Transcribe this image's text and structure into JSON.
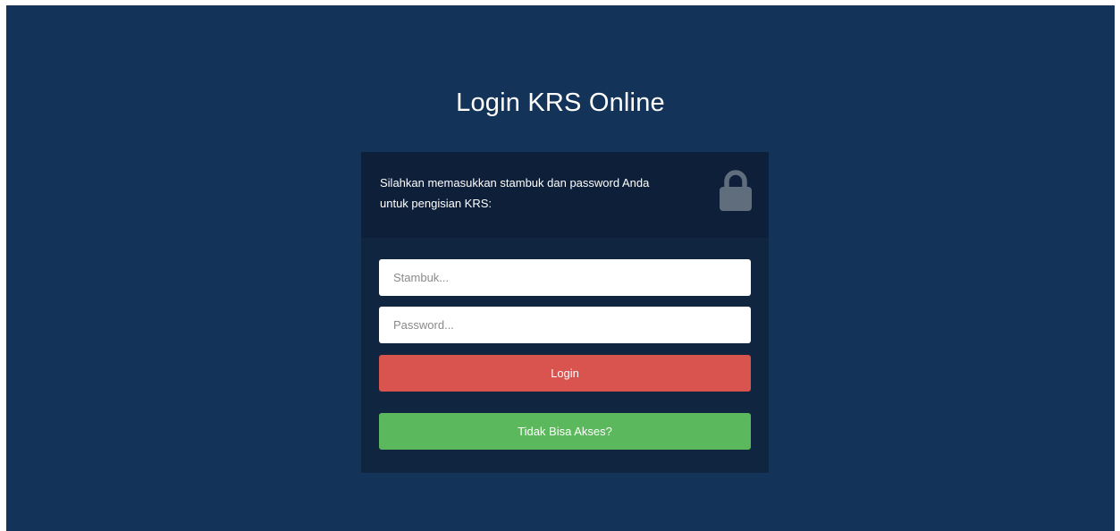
{
  "page": {
    "title": "Login KRS Online"
  },
  "login_card": {
    "instruction_line1": "Silahkan memasukkan stambuk dan password Anda",
    "instruction_line2": "untuk pengisian KRS:",
    "header_icon": "lock-icon",
    "stambuk_placeholder": "Stambuk...",
    "stambuk_value": "",
    "password_placeholder": "Password...",
    "password_value": "",
    "login_label": "Login",
    "help_label": "Tidak Bisa Akses?"
  },
  "colors": {
    "background": "#143358",
    "card": "#10253f",
    "card_header": "#0e2039",
    "login_button": "#d9534f",
    "help_button": "#5cb85c",
    "lock_icon": "#5f6d7c"
  }
}
